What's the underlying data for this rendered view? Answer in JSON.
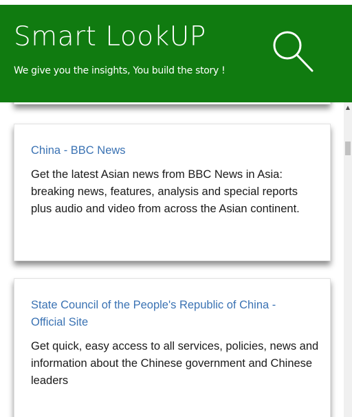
{
  "header": {
    "title": "Smart LookUP",
    "tagline": "We give you the insights, You build the story !",
    "background": "#107b10",
    "search_icon": "search-icon"
  },
  "results": [
    {
      "title": "China - BBC News",
      "description": "Get the latest Asian news from BBC News in Asia: breaking news, features, analysis and special reports plus audio and video from across the Asian continent."
    },
    {
      "title": "State Council of the People's Republic of China - Official Site",
      "description": "Get quick, easy access to all services, policies, news and information about the Chinese government and Chinese leaders"
    }
  ],
  "colors": {
    "link": "#3a72b3",
    "text": "#1a1a1a"
  },
  "scrollbar": {
    "up_arrow": "▲"
  }
}
